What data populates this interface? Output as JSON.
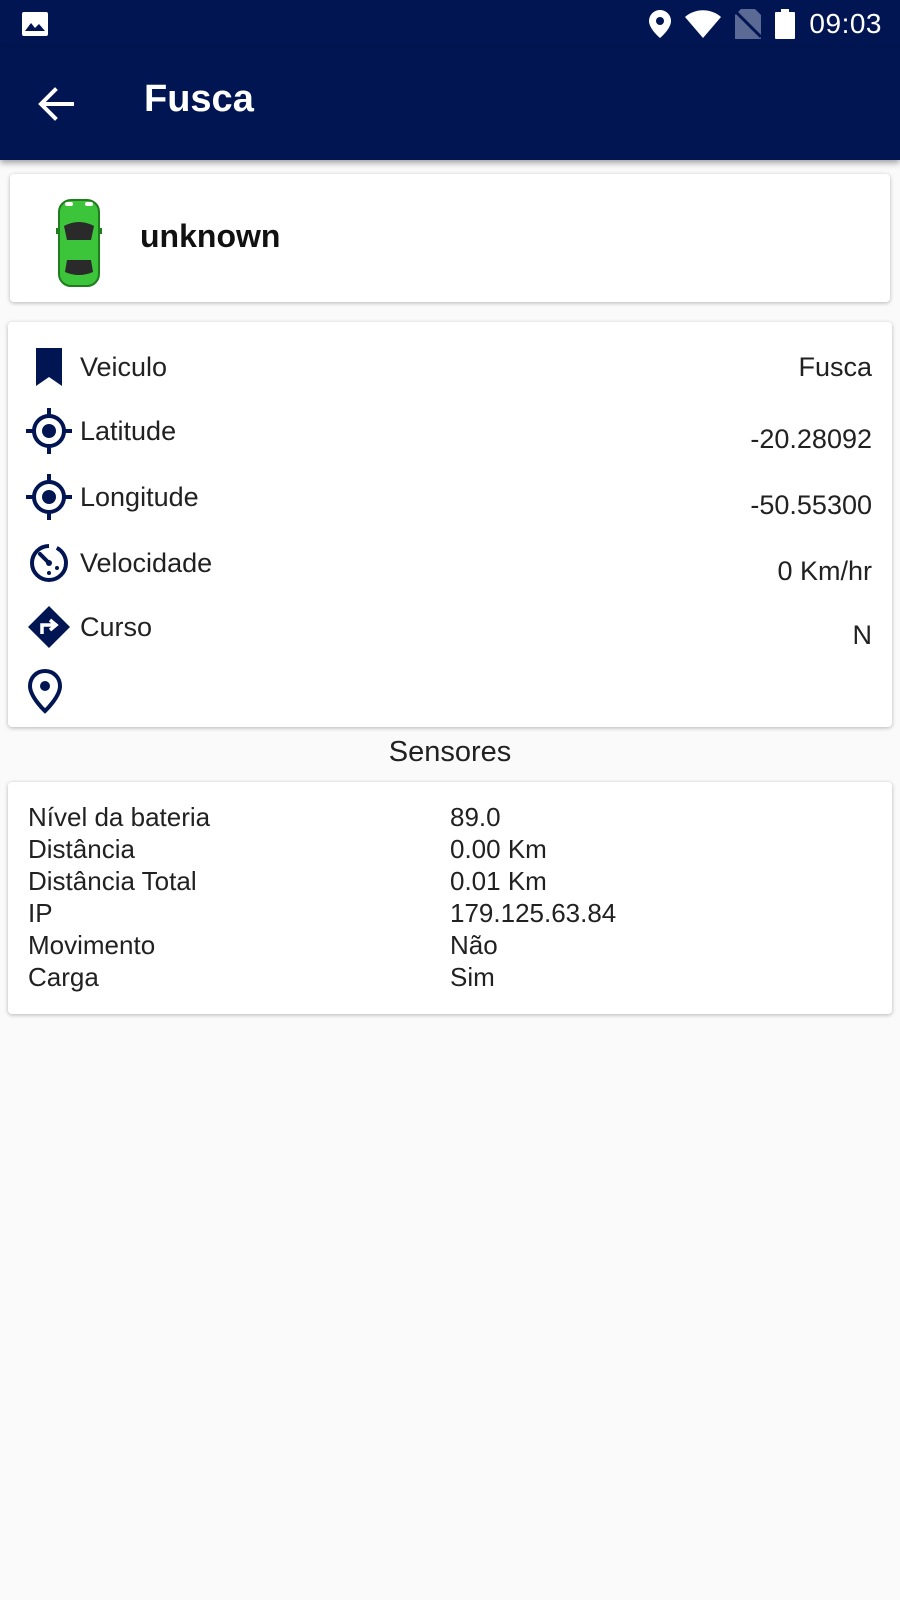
{
  "status_bar": {
    "time": "09:03",
    "icons": [
      "image-icon",
      "location-icon",
      "wifi-icon",
      "no-sim-icon",
      "battery-icon"
    ]
  },
  "app_bar": {
    "title": "Fusca",
    "back_icon": "arrow-back-icon"
  },
  "device": {
    "name": "unknown",
    "icon": "car-icon",
    "car_color": "#3cc43a"
  },
  "info": [
    {
      "icon": "bookmark-icon",
      "label": "Veiculo",
      "value": "Fusca"
    },
    {
      "icon": "crosshair-icon",
      "label": "Latitude",
      "value": "-20.28092"
    },
    {
      "icon": "crosshair-icon",
      "label": "Longitude",
      "value": "-50.55300"
    },
    {
      "icon": "speedometer-icon",
      "label": "Velocidade",
      "value": "0 Km/hr"
    },
    {
      "icon": "direction-icon",
      "label": "Curso",
      "value": "N"
    },
    {
      "icon": "map-pin-icon",
      "label": "",
      "value": ""
    }
  ],
  "sensors": {
    "title": "Sensores",
    "rows": [
      {
        "label": "Nível da bateria",
        "value": "89.0"
      },
      {
        "label": "Distância",
        "value": "0.00 Km"
      },
      {
        "label": "Distância Total",
        "value": "0.01 Km"
      },
      {
        "label": "IP",
        "value": "179.125.63.84"
      },
      {
        "label": "Movimento",
        "value": "Não"
      },
      {
        "label": "Carga",
        "value": "Sim"
      }
    ]
  },
  "colors": {
    "primary": "#011552",
    "background": "#fafafa",
    "card": "#ffffff",
    "text": "#212121"
  }
}
